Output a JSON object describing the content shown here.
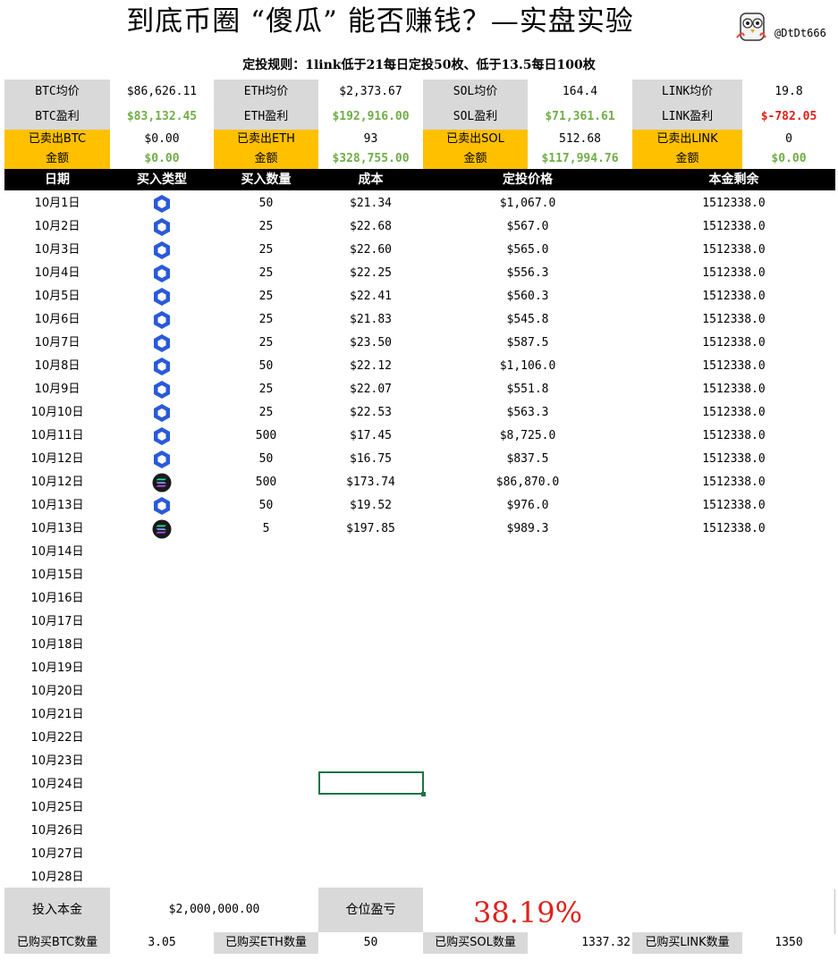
{
  "title": "到底币圈 “傻瓜” 能否赚钱？—实盘实验",
  "handle": "@DtDt666",
  "rule": "定投规则：1link低于21每日定投50枚、低于13.5每日100枚",
  "summary": {
    "avg": [
      {
        "label": "BTC均价",
        "value": "$86,626.11"
      },
      {
        "label": "ETH均价",
        "value": "$2,373.67"
      },
      {
        "label": "SOL均价",
        "value": "164.4"
      },
      {
        "label": "LINK均价",
        "value": "19.8"
      }
    ],
    "profit": [
      {
        "label": "BTC盈利",
        "value": "$83,132.45",
        "color": "#70ad47"
      },
      {
        "label": "ETH盈利",
        "value": "$192,916.00",
        "color": "#70ad47"
      },
      {
        "label": "SOL盈利",
        "value": "$71,361.61",
        "color": "#70ad47"
      },
      {
        "label": "LINK盈利",
        "value": "$-782.05",
        "color": "#e0201a"
      }
    ],
    "sold": [
      {
        "label1": "已卖出BTC",
        "label2": "金额",
        "qty": "$0.00",
        "amount": "$0.00"
      },
      {
        "label1": "已卖出ETH",
        "label2": "金额",
        "qty": "93",
        "amount": "$328,755.00"
      },
      {
        "label1": "已卖出SOL",
        "label2": "金额",
        "qty": "512.68",
        "amount": "$117,994.76"
      },
      {
        "label1": "已卖出LINK",
        "label2": "金额",
        "qty": "0",
        "amount": "$0.00"
      }
    ]
  },
  "table": {
    "headers": [
      "日期",
      "买入类型",
      "买入数量",
      "成本",
      "定投价格",
      "本金剩余"
    ],
    "rows": [
      {
        "date": "10月1日",
        "type": "link-icon",
        "qty": "50",
        "cost": "$21.34",
        "price": "$1,067.0",
        "remain": "1512338.0"
      },
      {
        "date": "10月2日",
        "type": "link-icon",
        "qty": "25",
        "cost": "$22.68",
        "price": "$567.0",
        "remain": "1512338.0"
      },
      {
        "date": "10月3日",
        "type": "link-icon",
        "qty": "25",
        "cost": "$22.60",
        "price": "$565.0",
        "remain": "1512338.0"
      },
      {
        "date": "10月4日",
        "type": "link-icon",
        "qty": "25",
        "cost": "$22.25",
        "price": "$556.3",
        "remain": "1512338.0"
      },
      {
        "date": "10月5日",
        "type": "link-icon",
        "qty": "25",
        "cost": "$22.41",
        "price": "$560.3",
        "remain": "1512338.0"
      },
      {
        "date": "10月6日",
        "type": "link-icon",
        "qty": "25",
        "cost": "$21.83",
        "price": "$545.8",
        "remain": "1512338.0"
      },
      {
        "date": "10月7日",
        "type": "link-icon",
        "qty": "25",
        "cost": "$23.50",
        "price": "$587.5",
        "remain": "1512338.0"
      },
      {
        "date": "10月8日",
        "type": "link-icon",
        "qty": "50",
        "cost": "$22.12",
        "price": "$1,106.0",
        "remain": "1512338.0"
      },
      {
        "date": "10月9日",
        "type": "link-icon",
        "qty": "25",
        "cost": "$22.07",
        "price": "$551.8",
        "remain": "1512338.0"
      },
      {
        "date": "10月10日",
        "type": "link-icon",
        "qty": "25",
        "cost": "$22.53",
        "price": "$563.3",
        "remain": "1512338.0"
      },
      {
        "date": "10月11日",
        "type": "link-icon",
        "qty": "500",
        "cost": "$17.45",
        "price": "$8,725.0",
        "remain": "1512338.0"
      },
      {
        "date": "10月12日",
        "type": "link-icon",
        "qty": "50",
        "cost": "$16.75",
        "price": "$837.5",
        "remain": "1512338.0"
      },
      {
        "date": "10月12日",
        "type": "sol-icon",
        "qty": "500",
        "cost": "$173.74",
        "price": "$86,870.0",
        "remain": "1512338.0"
      },
      {
        "date": "10月13日",
        "type": "link-icon",
        "qty": "50",
        "cost": "$19.52",
        "price": "$976.0",
        "remain": "1512338.0"
      },
      {
        "date": "10月13日",
        "type": "sol-icon",
        "qty": "5",
        "cost": "$197.85",
        "price": "$989.3",
        "remain": "1512338.0"
      },
      {
        "date": "10月14日",
        "type": "",
        "qty": "",
        "cost": "",
        "price": "",
        "remain": ""
      },
      {
        "date": "10月15日",
        "type": "",
        "qty": "",
        "cost": "",
        "price": "",
        "remain": ""
      },
      {
        "date": "10月16日",
        "type": "",
        "qty": "",
        "cost": "",
        "price": "",
        "remain": ""
      },
      {
        "date": "10月17日",
        "type": "",
        "qty": "",
        "cost": "",
        "price": "",
        "remain": ""
      },
      {
        "date": "10月18日",
        "type": "",
        "qty": "",
        "cost": "",
        "price": "",
        "remain": ""
      },
      {
        "date": "10月19日",
        "type": "",
        "qty": "",
        "cost": "",
        "price": "",
        "remain": ""
      },
      {
        "date": "10月20日",
        "type": "",
        "qty": "",
        "cost": "",
        "price": "",
        "remain": ""
      },
      {
        "date": "10月21日",
        "type": "",
        "qty": "",
        "cost": "",
        "price": "",
        "remain": ""
      },
      {
        "date": "10月22日",
        "type": "",
        "qty": "",
        "cost": "",
        "price": "",
        "remain": ""
      },
      {
        "date": "10月23日",
        "type": "",
        "qty": "",
        "cost": "",
        "price": "",
        "remain": ""
      },
      {
        "date": "10月24日",
        "type": "",
        "qty": "",
        "cost": "",
        "price": "",
        "remain": ""
      },
      {
        "date": "10月25日",
        "type": "",
        "qty": "",
        "cost": "",
        "price": "",
        "remain": ""
      },
      {
        "date": "10月26日",
        "type": "",
        "qty": "",
        "cost": "",
        "price": "",
        "remain": ""
      },
      {
        "date": "10月27日",
        "type": "",
        "qty": "",
        "cost": "",
        "price": "",
        "remain": ""
      },
      {
        "date": "10月28日",
        "type": "",
        "qty": "",
        "cost": "",
        "price": "",
        "remain": ""
      }
    ]
  },
  "footer": {
    "principal_label": "投入本金",
    "principal_value": "$2,000,000.00",
    "pnl_label": "仓位盈亏",
    "pnl_value": "38.19%",
    "bought": [
      {
        "label": "已购买BTC数量",
        "value": "3.05"
      },
      {
        "label": "已购买ETH数量",
        "value": "50"
      },
      {
        "label": "已购买SOL数量",
        "value": "1337.32"
      },
      {
        "label": "已购买LINK数量",
        "value": "1350"
      }
    ]
  },
  "colors": {
    "gray": "#d9d9d9",
    "gold": "#ffc000",
    "green": "#70ad47",
    "red": "#e0201a",
    "link": "#2a5ada",
    "sol_bg": "#1a1a1a",
    "selection": "#217346"
  }
}
